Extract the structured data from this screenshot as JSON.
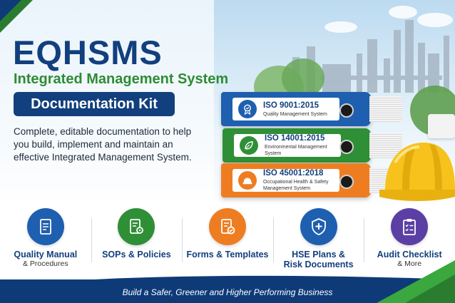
{
  "header": {
    "title": "EQHSMS",
    "subtitle": "Integrated Management System",
    "badge": "Documentation Kit",
    "description": "Complete, editable documentation to help you build, implement and maintain an effective Integrated Management System."
  },
  "binders": [
    {
      "standard": "ISO 9001:2015",
      "name": "Quality Management System",
      "icon": "quality-badge-icon",
      "color": "#1f5fb0",
      "icon_color": "#1f5fb0"
    },
    {
      "standard": "ISO 14001:2015",
      "name": "Environmental Management System",
      "icon": "leaf-icon",
      "color": "#2f8f36",
      "icon_color": "#2f8f36"
    },
    {
      "standard": "ISO 45001:2018",
      "name": "Occupational Health & Safety Management System",
      "icon": "hard-hat-icon",
      "color": "#ee7d22",
      "icon_color": "#ee7d22"
    }
  ],
  "features": [
    {
      "line1": "Quality Manual",
      "line2": "& Procedures",
      "icon": "manual-document-icon",
      "color": "#1f5fb0"
    },
    {
      "line1": "SOPs & Policies",
      "line2": "",
      "icon": "document-gear-icon",
      "color": "#2f8f36"
    },
    {
      "line1": "Forms & Templates",
      "line2": "",
      "icon": "document-check-icon",
      "color": "#ee7d22"
    },
    {
      "line1": "HSE Plans &",
      "line2": "Risk Documents",
      "icon": "shield-plus-icon",
      "color": "#1f5fb0"
    },
    {
      "line1": "Audit Checklist",
      "line2": "& More",
      "icon": "clipboard-checklist-icon",
      "color": "#5b3fa5"
    }
  ],
  "footer": {
    "tagline": "Build a Safer, Greener and Higher Performing Business"
  },
  "colors": {
    "navy": "#123f7d",
    "green": "#2e8b34",
    "orange": "#ee7d22",
    "purple": "#5b3fa5"
  }
}
